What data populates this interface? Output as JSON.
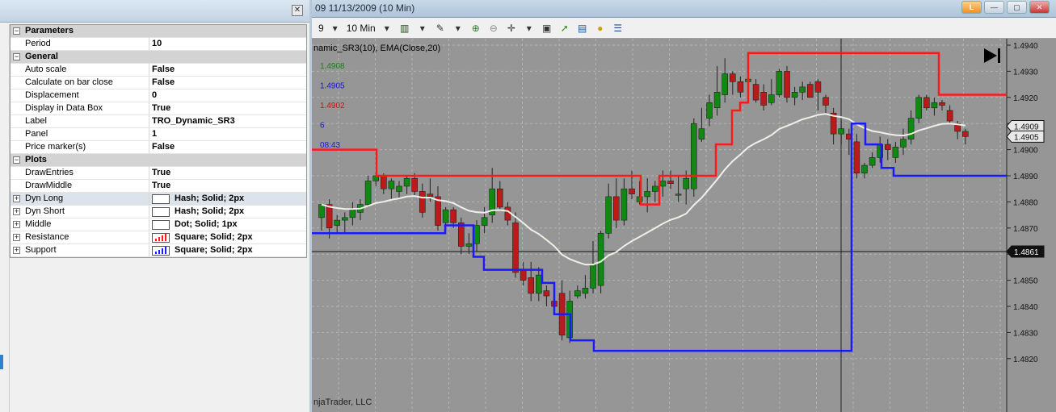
{
  "window": {
    "title": "09  11/13/2009 (10 Min)",
    "btn_orange": "L"
  },
  "toolbar": {
    "bar_period_prefix": "9",
    "interval": "10 Min"
  },
  "chart": {
    "indicator_label": "namic_SR3(10), EMA(Close,20)",
    "footer": "njaTrader, LLC",
    "left_values": [
      "1.4908",
      "1.4905",
      "1.4902",
      "6",
      "08:43"
    ],
    "left_colors": [
      "#188018",
      "#1818d0",
      "#c01818",
      "#1818d0",
      "#1818d0"
    ],
    "price_ticks": [
      "1.4940",
      "1.4930",
      "1.4920",
      "1.4910",
      "1.4900",
      "1.4890",
      "1.4880",
      "1.4870",
      "1.4860",
      "1.4850",
      "1.4840",
      "1.4830",
      "1.4820"
    ],
    "markers": [
      {
        "label": "1.4909",
        "value": 1.4909
      },
      {
        "label": "1.4905",
        "value": 1.4905
      },
      {
        "label": "1.4861",
        "value": 1.4861
      }
    ],
    "colors": {
      "resistance": "#ff1a1a",
      "support": "#1a1aff",
      "ema": "#f0f0e8",
      "bull": "#118811",
      "bear": "#bb1a1a"
    }
  },
  "properties": {
    "sections": [
      {
        "name": "Parameters",
        "rows": [
          {
            "k": "Period",
            "v": "10"
          }
        ]
      },
      {
        "name": "General",
        "rows": [
          {
            "k": "Auto scale",
            "v": "False"
          },
          {
            "k": "Calculate on bar close",
            "v": "False"
          },
          {
            "k": "Displacement",
            "v": "0"
          },
          {
            "k": "Display in Data Box",
            "v": "True"
          },
          {
            "k": "Label",
            "v": "TRO_Dynamic_SR3"
          },
          {
            "k": "Panel",
            "v": "1"
          },
          {
            "k": "Price marker(s)",
            "v": "False"
          }
        ]
      },
      {
        "name": "Plots",
        "rows": [
          {
            "k": "DrawEntries",
            "v": "True"
          },
          {
            "k": "DrawMiddle",
            "v": "True"
          },
          {
            "k": "Dyn Long",
            "v": "Hash; Solid; 2px",
            "swatch": "blank"
          },
          {
            "k": "Dyn Short",
            "v": "Hash; Solid; 2px",
            "swatch": "blank"
          },
          {
            "k": "Middle",
            "v": "Dot; Solid; 1px",
            "swatch": "blank"
          },
          {
            "k": "Resistance",
            "v": "Square; Solid; 2px",
            "swatch": "red"
          },
          {
            "k": "Support",
            "v": "Square; Solid; 2px",
            "swatch": "blue"
          }
        ]
      }
    ]
  }
}
